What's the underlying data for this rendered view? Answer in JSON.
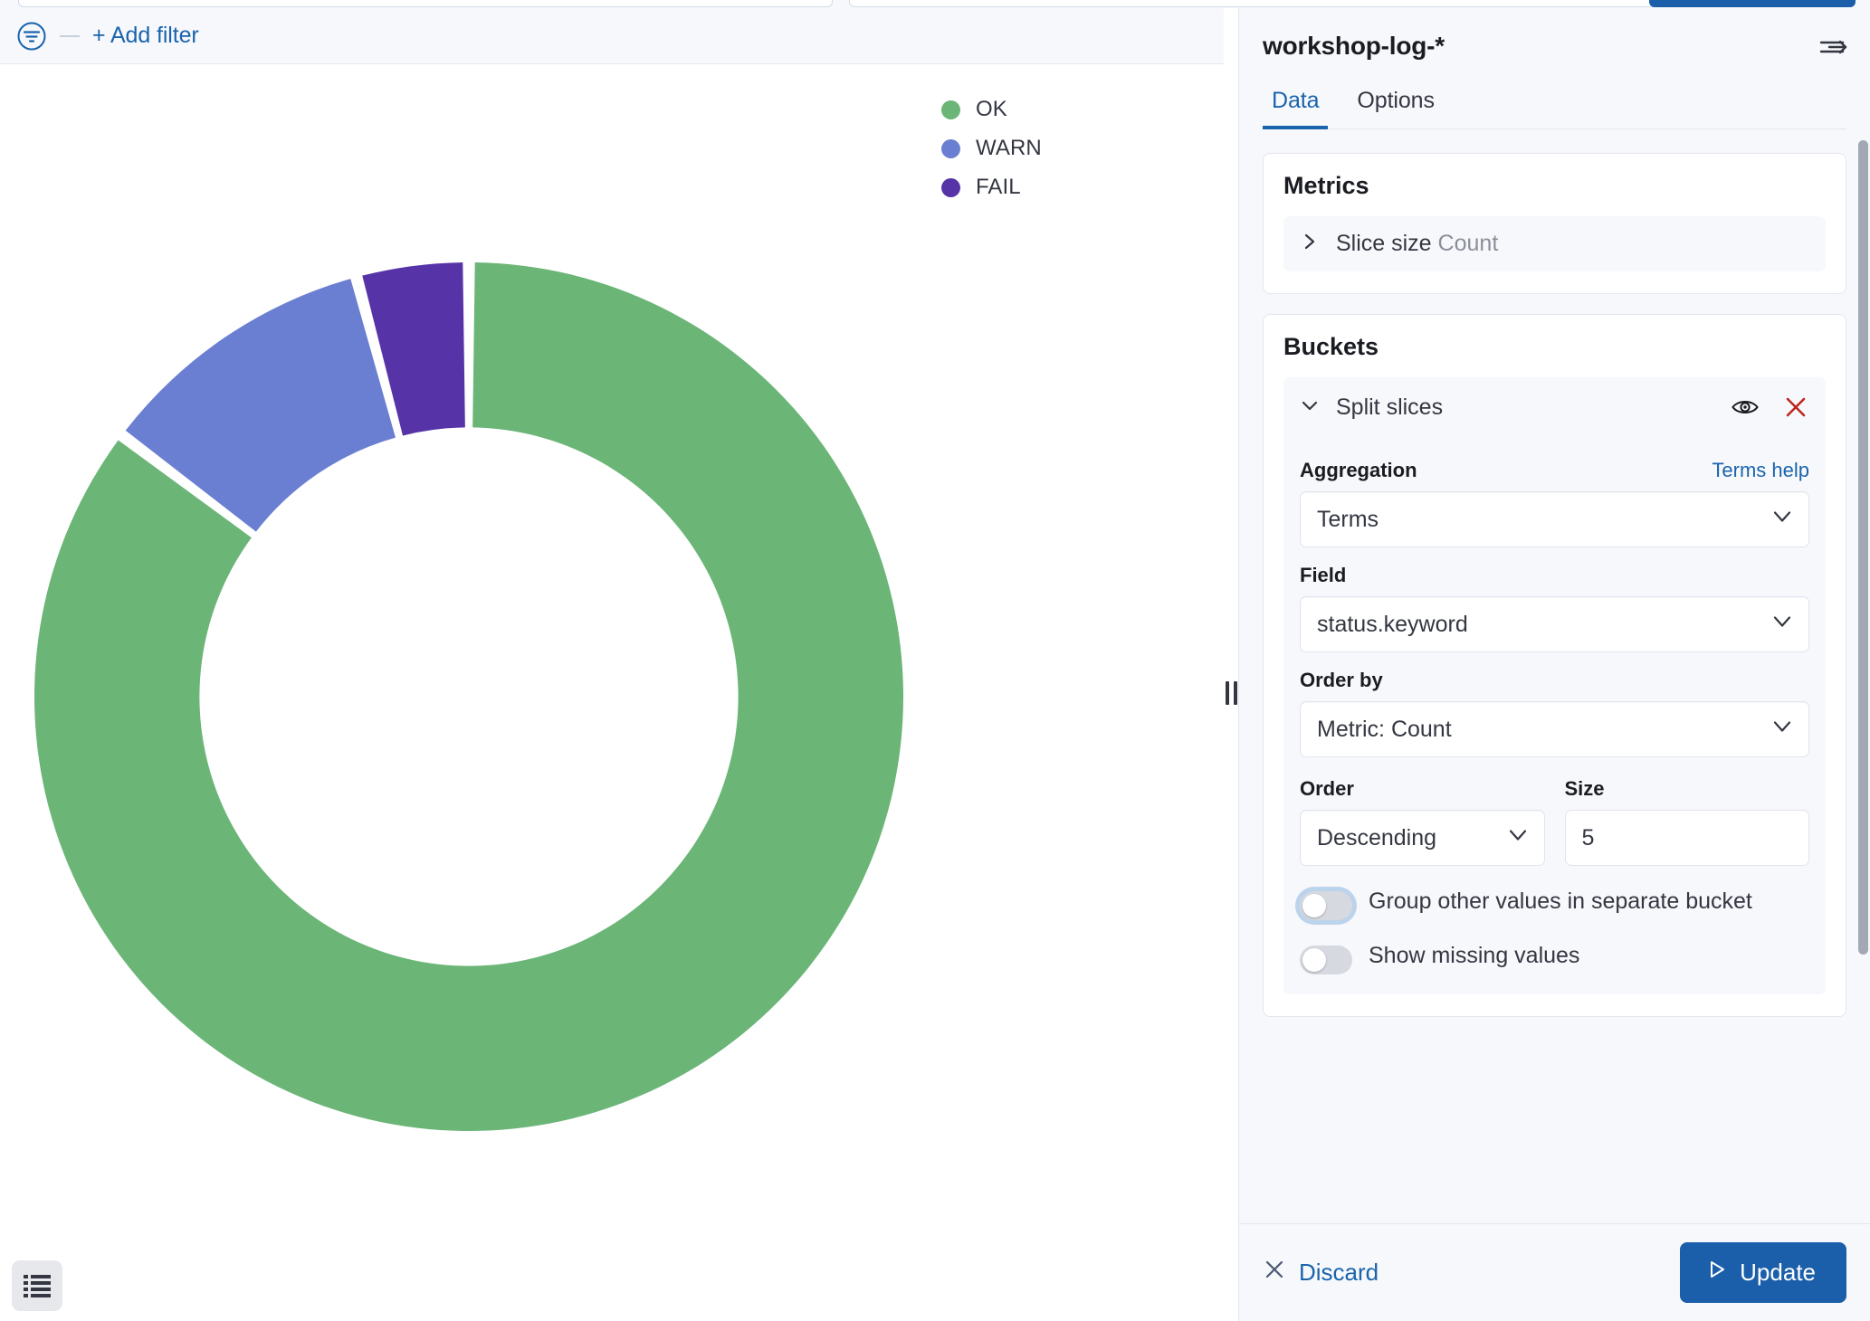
{
  "filter_bar": {
    "filter_icon": "filter-icon",
    "dash": "—",
    "add_filter_label": "+ Add filter"
  },
  "chart_data": {
    "type": "pie",
    "variant": "donut",
    "title": "",
    "labels": [
      "OK",
      "WARN",
      "FAIL"
    ],
    "values": [
      85.3,
      10.6,
      4.1
    ],
    "colors": [
      "#6BB577",
      "#6A7FD2",
      "#5733A8"
    ],
    "legend_position": "top-right",
    "start_angle_deg": 0,
    "inner_radius_ratio": 0.62,
    "slice_angles_deg": [
      {
        "label": "OK",
        "start": 0,
        "end": 307
      },
      {
        "label": "WARN",
        "start": 307,
        "end": 345
      },
      {
        "label": "FAIL",
        "start": 345,
        "end": 360
      }
    ]
  },
  "legend": [
    {
      "label": "OK",
      "color": "#6BB577"
    },
    {
      "label": "WARN",
      "color": "#6A7FD2"
    },
    {
      "label": "FAIL",
      "color": "#5733A8"
    }
  ],
  "inspect_button": "list-icon",
  "panel": {
    "title": "workshop-log-*",
    "collapse_icon": "collapse-panel-icon",
    "tabs": [
      {
        "label": "Data",
        "active": true
      },
      {
        "label": "Options",
        "active": false
      }
    ],
    "metrics": {
      "card_title": "Metrics",
      "rows": [
        {
          "expand_icon": "chevron-right-icon",
          "label": "Slice size",
          "value": "Count"
        }
      ]
    },
    "buckets": {
      "card_title": "Buckets",
      "bucket": {
        "collapse_icon": "chevron-down-icon",
        "label": "Split slices",
        "toggle_visibility_icon": "eye-icon",
        "remove_icon": "close-icon",
        "remove_color": "#BD271E",
        "aggregation_label": "Aggregation",
        "help_link": "Terms help",
        "aggregation_value": "Terms",
        "field_label": "Field",
        "field_value": "status.keyword",
        "order_by_label": "Order by",
        "order_by_value": "Metric: Count",
        "order_label": "Order",
        "order_value": "Descending",
        "size_label": "Size",
        "size_value": "5",
        "group_other_label": "Group other values in separate bucket",
        "group_other_on": false,
        "show_missing_label": "Show missing values",
        "show_missing_on": false
      }
    },
    "footer": {
      "discard_icon": "close-icon",
      "discard_label": "Discard",
      "update_icon": "play-icon",
      "update_label": "Update",
      "update_color": "#1b5faa"
    }
  }
}
